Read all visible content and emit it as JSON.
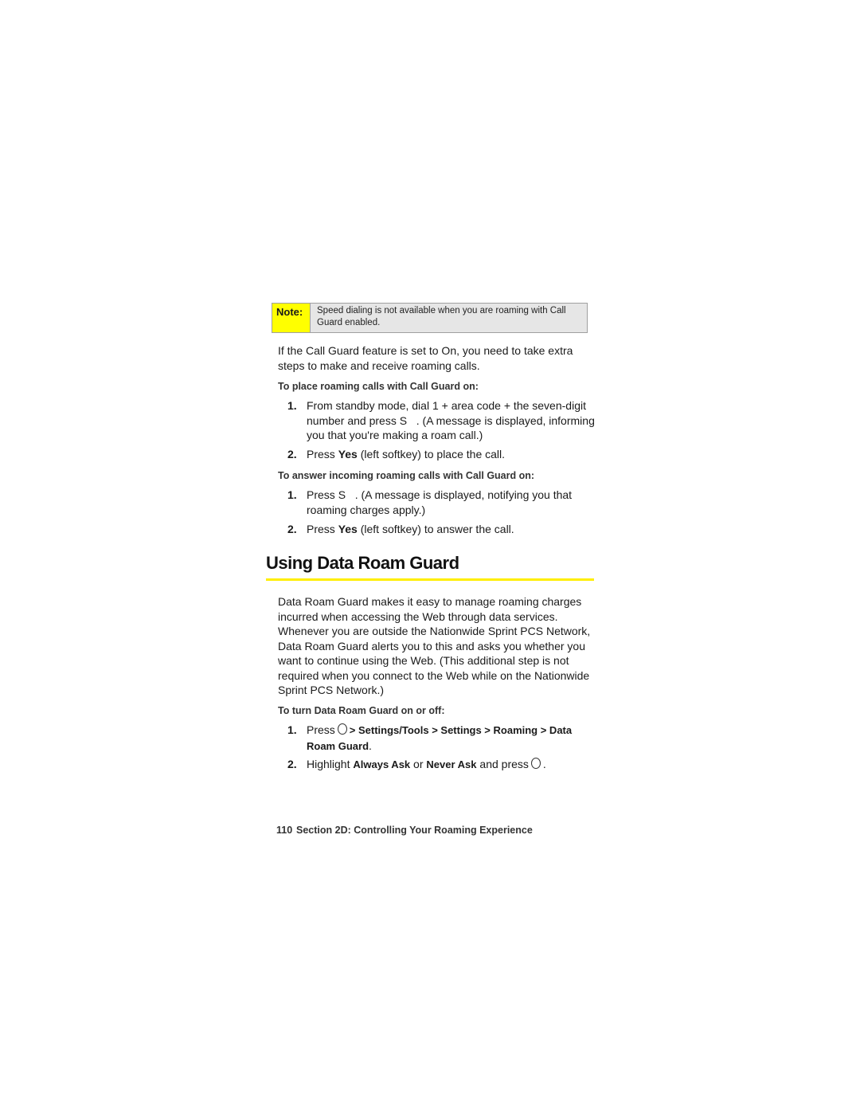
{
  "note": {
    "label": "Note:",
    "text": "Speed dialing is not available when you are roaming with Call Guard enabled."
  },
  "intro": "If the Call Guard feature is set to On, you need to take extra steps to make and receive roaming calls.",
  "place_calls": {
    "heading": "To place roaming calls with Call Guard on:",
    "steps": [
      {
        "num": "1.",
        "pre": "From standby mode, dial 1 + area code + the seven-digit number and press",
        "key": "S",
        "post": ". (A message is displayed, informing you that you're making a roam call.)"
      },
      {
        "num": "2.",
        "pre": "Press",
        "bold": "Yes",
        "post": "(left softkey) to place the call."
      }
    ]
  },
  "answer_calls": {
    "heading": "To answer incoming roaming calls with Call Guard on:",
    "steps": [
      {
        "num": "1.",
        "pre": "Press",
        "key": "S",
        "post": ". (A message is displayed, notifying you that roaming charges apply.)"
      },
      {
        "num": "2.",
        "pre": "Press",
        "bold": "Yes",
        "post": "(left softkey) to answer the call."
      }
    ]
  },
  "section_title": "Using Data Roam Guard",
  "data_roam_paragraph": "Data Roam Guard makes it easy to manage roaming charges incurred when accessing the Web through data services. Whenever you are outside the Nationwide Sprint PCS Network, Data Roam Guard alerts you to this and asks you whether you want to continue using the Web. (This additional step is not required when you connect to the Web while on the Nationwide Sprint PCS Network.)",
  "turn_on_off": {
    "heading": "To turn Data Roam Guard on or off:",
    "steps": [
      {
        "num": "1.",
        "pre": "Press",
        "key_icon": "menu-ok-key",
        "path": "> Settings/Tools > Settings > Roaming > Data Roam Guard",
        "post": "."
      },
      {
        "num": "2.",
        "pre": "Highlight",
        "opt1": "Always Ask",
        "mid": "or",
        "opt2": "Never Ask",
        "post2": "and press",
        "end": "."
      }
    ]
  },
  "footer": {
    "page_number": "110",
    "section": "Section 2D: Controlling Your Roaming Experience"
  }
}
